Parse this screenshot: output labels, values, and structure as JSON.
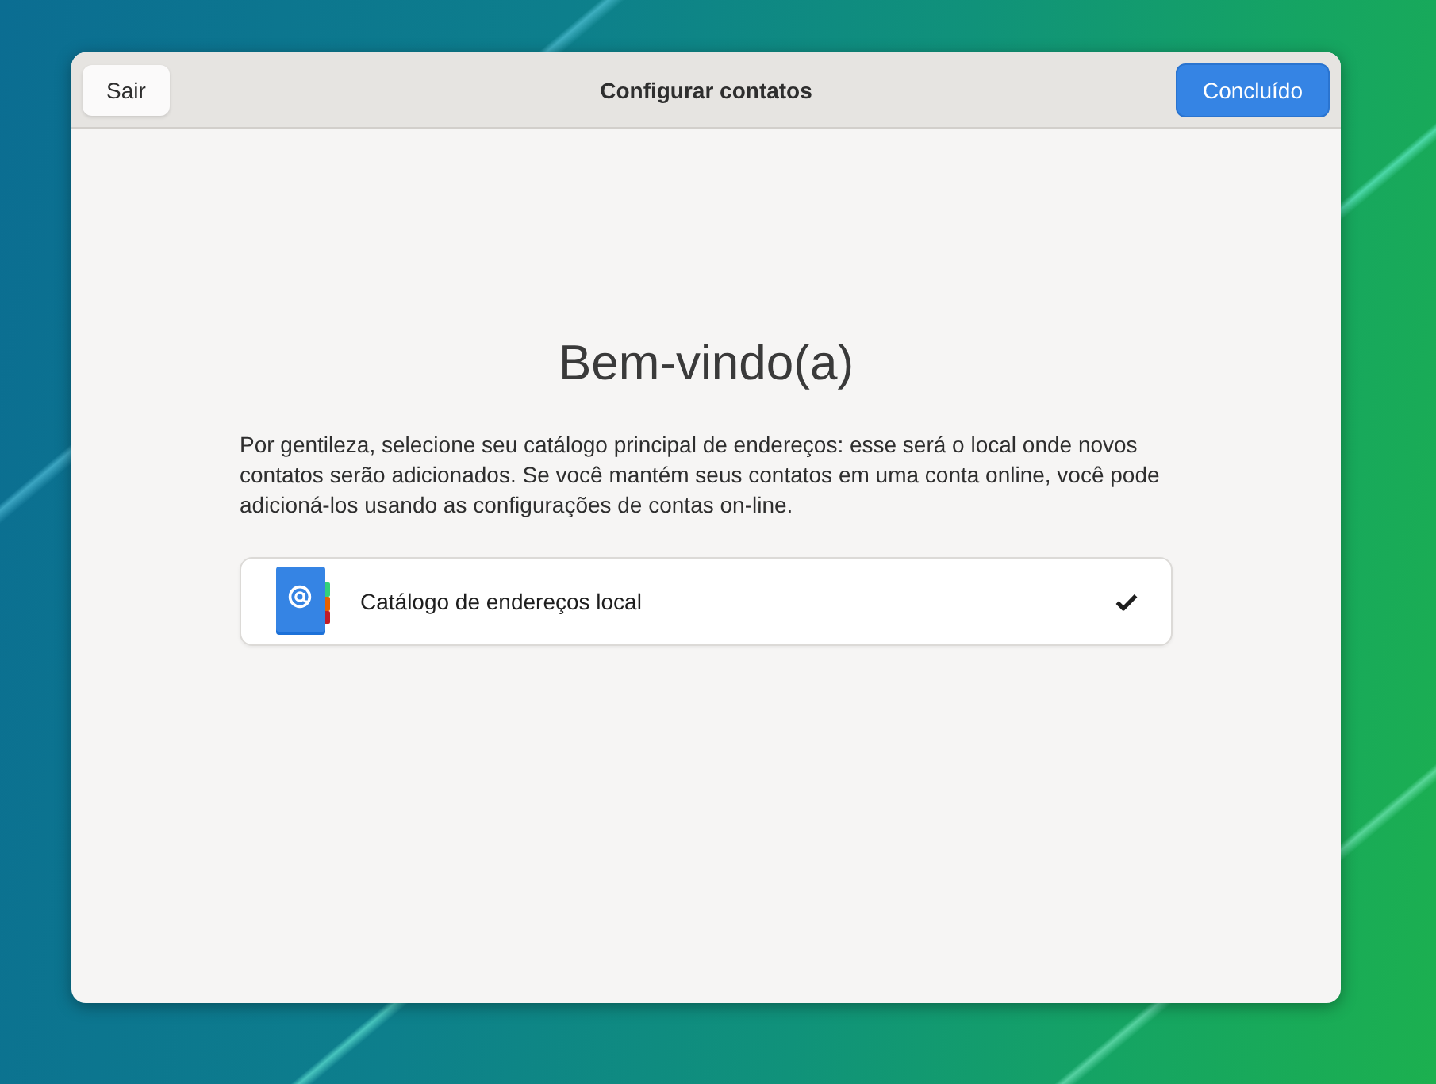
{
  "window": {
    "title": "Configurar contatos"
  },
  "header_buttons": [
    {
      "label": "Sair",
      "kind": "plain"
    },
    {
      "label": "Concluído",
      "kind": "suggested"
    }
  ],
  "welcome": {
    "heading": "Bem-vindo(a)",
    "description": "Por gentileza, selecione seu catálogo principal de endereços: esse será o local onde novos contatos serão adicionados. Se você mantém seus contatos em uma conta online, você pode adicioná-los usando as configurações de contas on-line."
  },
  "address_books": [
    {
      "name": "Catálogo de endereços local",
      "selected": true
    }
  ]
}
